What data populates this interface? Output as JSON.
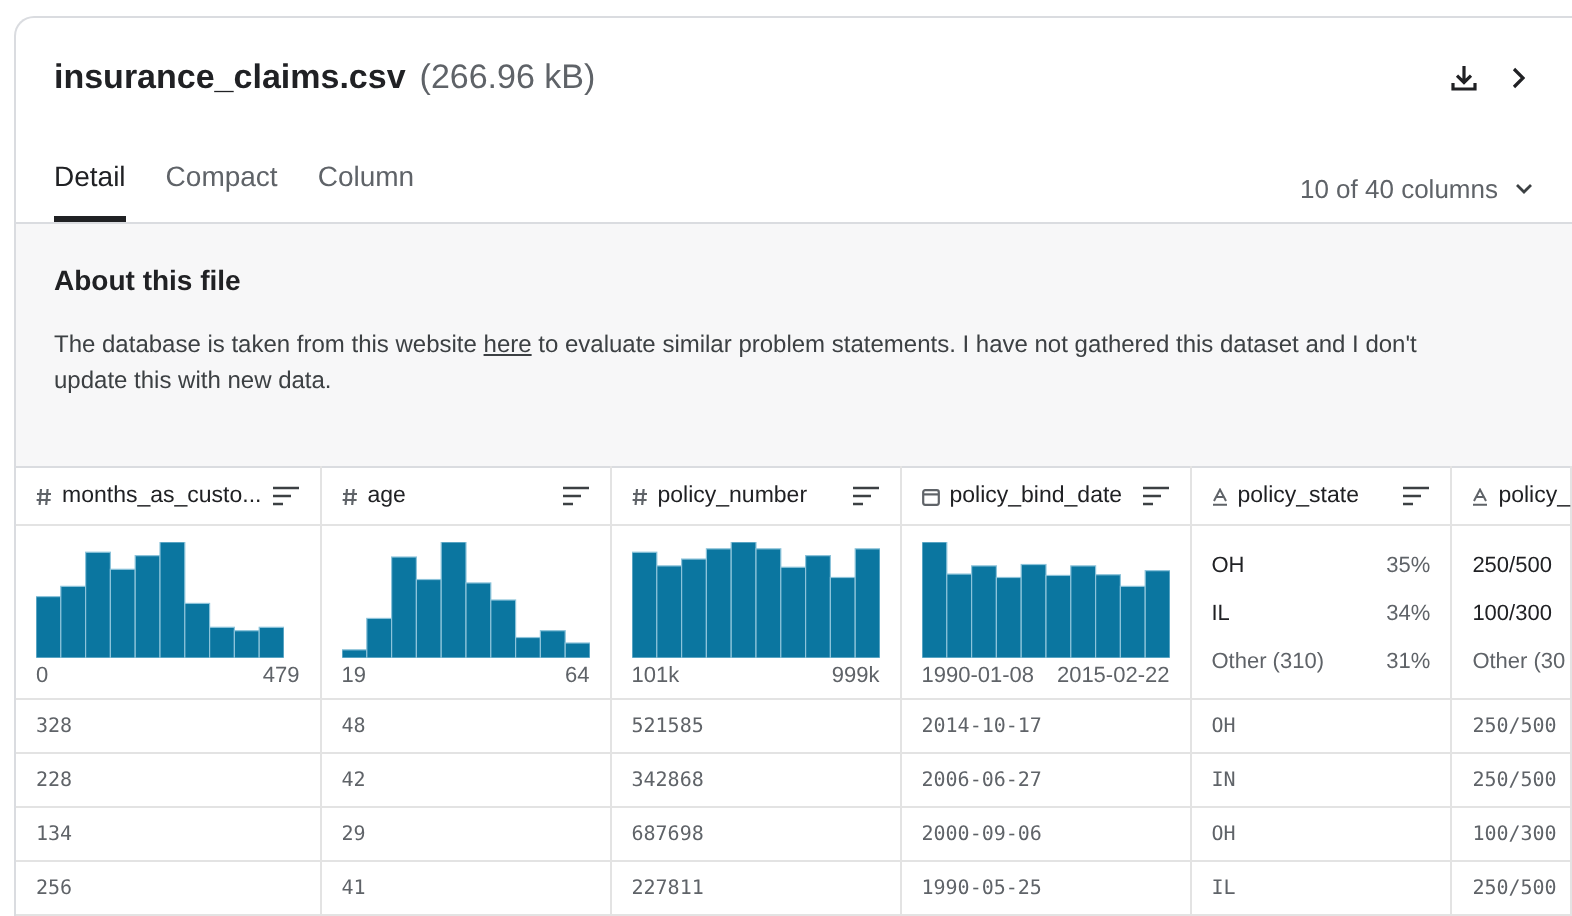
{
  "file": {
    "name": "insurance_claims.csv",
    "size": "(266.96 kB)"
  },
  "tabs": [
    {
      "label": "Detail",
      "selected": true
    },
    {
      "label": "Compact",
      "selected": false
    },
    {
      "label": "Column",
      "selected": false
    }
  ],
  "column_picker": {
    "label": "10 of 40 columns"
  },
  "about": {
    "title": "About this file",
    "text_before": "The database is taken from this website ",
    "link": "here",
    "text_after": " to evaluate similar problem statements. I have not gathered this dataset and I don't update this with new data."
  },
  "table": {
    "columns": [
      {
        "name": "months_as_custo...",
        "kind": "number",
        "sortable": true,
        "summary": {
          "kind": "histogram",
          "min": "0",
          "max": "479"
        }
      },
      {
        "name": "age",
        "kind": "number",
        "sortable": true,
        "summary": {
          "kind": "histogram",
          "min": "19",
          "max": "64"
        }
      },
      {
        "name": "policy_number",
        "kind": "number",
        "sortable": true,
        "summary": {
          "kind": "histogram",
          "min": "101k",
          "max": "999k"
        }
      },
      {
        "name": "policy_bind_date",
        "kind": "date",
        "sortable": true,
        "summary": {
          "kind": "histogram",
          "min": "1990-01-08",
          "max": "2015-02-22"
        }
      },
      {
        "name": "policy_state",
        "kind": "string",
        "sortable": true,
        "summary": {
          "kind": "categories",
          "items": [
            {
              "label": "OH",
              "share": "35%",
              "other": false
            },
            {
              "label": "IL",
              "share": "34%",
              "other": false
            },
            {
              "label": "Other (310)",
              "share": "31%",
              "other": true
            }
          ]
        }
      },
      {
        "name": "policy_",
        "kind": "string",
        "sortable": false,
        "summary": {
          "kind": "categories",
          "items": [
            {
              "label": "250/500",
              "other": false
            },
            {
              "label": "100/300",
              "other": false
            },
            {
              "label": "Other (30",
              "other": true
            }
          ]
        }
      }
    ],
    "rows": [
      [
        "328",
        "48",
        "521585",
        "2014-10-17",
        "OH",
        "250/500"
      ],
      [
        "228",
        "42",
        "342868",
        "2006-06-27",
        "IN",
        "250/500"
      ],
      [
        "134",
        "29",
        "687698",
        "2000-09-06",
        "OH",
        "100/300"
      ],
      [
        "256",
        "41",
        "227811",
        "1990-05-25",
        "IL",
        "250/500"
      ]
    ]
  }
}
